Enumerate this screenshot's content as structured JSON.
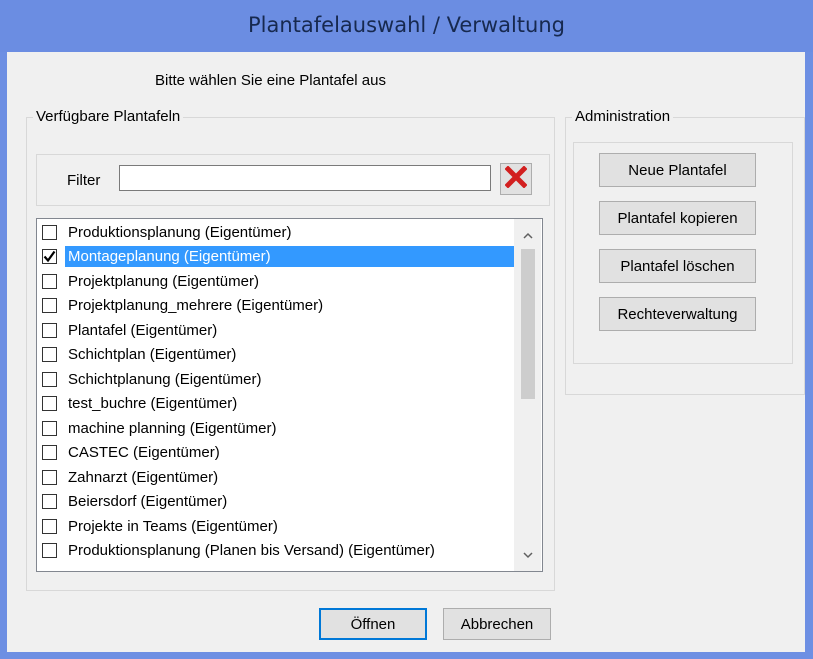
{
  "window": {
    "title": "Plantafelauswahl / Verwaltung"
  },
  "dialog": {
    "instruction": "Bitte wählen Sie eine Plantafel aus"
  },
  "available": {
    "legend": "Verfügbare Plantafeln",
    "filter": {
      "label": "Filter",
      "value": "",
      "placeholder": ""
    },
    "items": [
      {
        "label": "Produktionsplanung (Eigentümer)",
        "checked": false,
        "selected": false
      },
      {
        "label": "Montageplanung (Eigentümer)",
        "checked": true,
        "selected": true
      },
      {
        "label": "Projektplanung (Eigentümer)",
        "checked": false,
        "selected": false
      },
      {
        "label": "Projektplanung_mehrere (Eigentümer)",
        "checked": false,
        "selected": false
      },
      {
        "label": "Plantafel (Eigentümer)",
        "checked": false,
        "selected": false
      },
      {
        "label": "Schichtplan (Eigentümer)",
        "checked": false,
        "selected": false
      },
      {
        "label": "Schichtplanung (Eigentümer)",
        "checked": false,
        "selected": false
      },
      {
        "label": "test_buchre (Eigentümer)",
        "checked": false,
        "selected": false
      },
      {
        "label": "machine planning (Eigentümer)",
        "checked": false,
        "selected": false
      },
      {
        "label": "CASTEC (Eigentümer)",
        "checked": false,
        "selected": false
      },
      {
        "label": "Zahnarzt (Eigentümer)",
        "checked": false,
        "selected": false
      },
      {
        "label": "Beiersdorf (Eigentümer)",
        "checked": false,
        "selected": false
      },
      {
        "label": "Projekte in Teams (Eigentümer)",
        "checked": false,
        "selected": false
      },
      {
        "label": "Produktionsplanung (Planen bis Versand) (Eigentümer)",
        "checked": false,
        "selected": false
      }
    ]
  },
  "admin": {
    "legend": "Administration",
    "new_label": "Neue Plantafel",
    "copy_label": "Plantafel kopieren",
    "delete_label": "Plantafel löschen",
    "rights_label": "Rechteverwaltung"
  },
  "footer": {
    "open_label": "Öffnen",
    "cancel_label": "Abbrechen"
  },
  "icons": {
    "clear": "close-icon",
    "check": "checkmark-icon",
    "scroll_up": "chevron-up-icon",
    "scroll_down": "chevron-down-icon"
  },
  "colors": {
    "titlebar": "#6b8de2",
    "selection": "#3399ff",
    "clear_icon": "#d21f1f",
    "default_button_border": "#0078d7"
  }
}
